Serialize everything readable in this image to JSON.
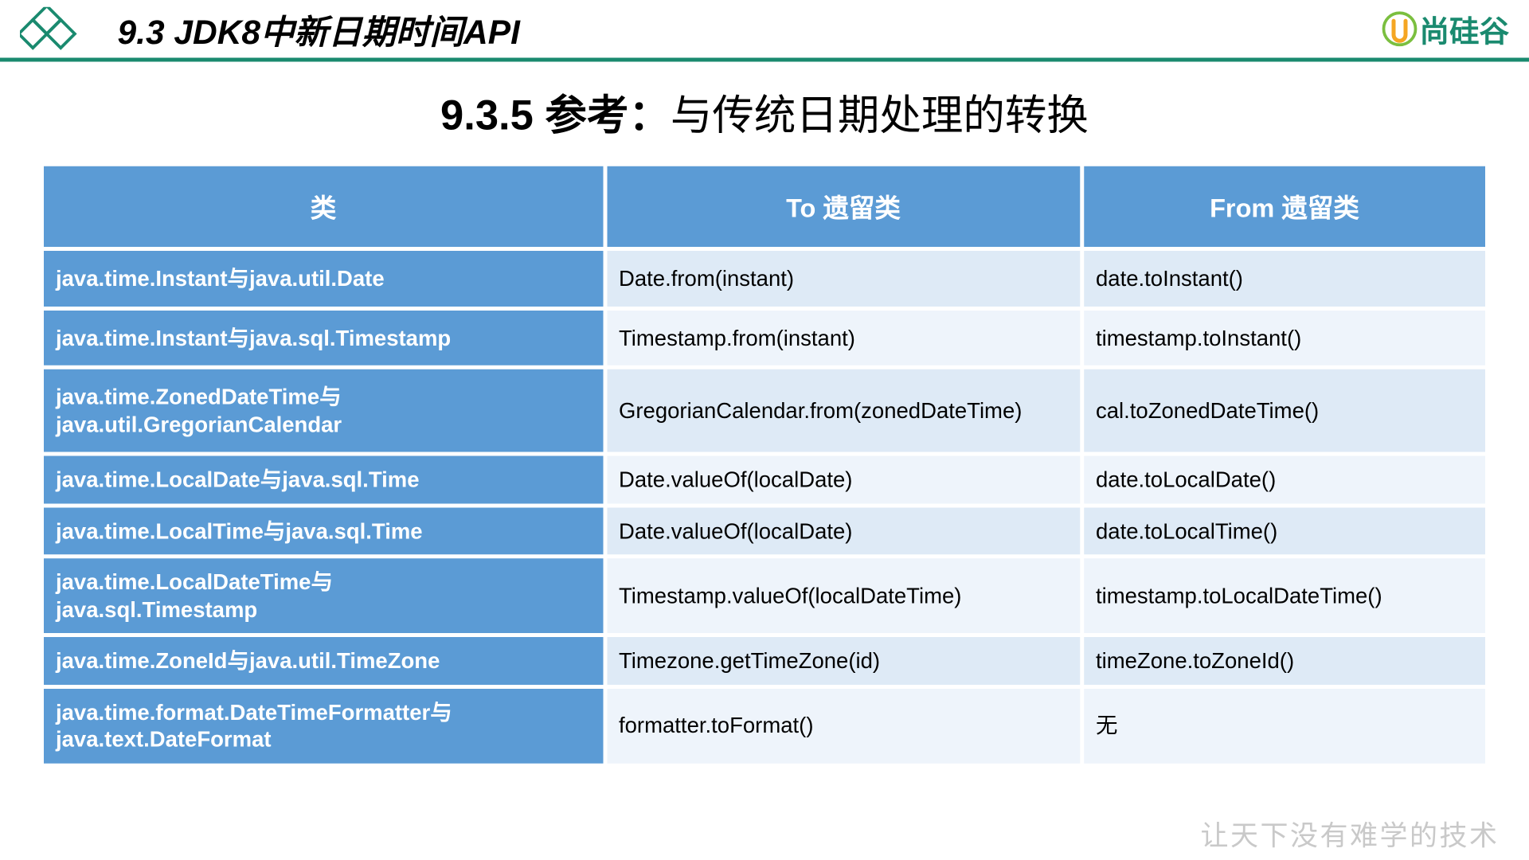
{
  "header": {
    "title": "9.3 JDK8中新日期时间API",
    "brand": "尚硅谷"
  },
  "subtitle": {
    "prefix_bold": "9.3.5 参考：",
    "rest": "与传统日期处理的转换"
  },
  "table": {
    "headers": {
      "class": "类",
      "to": "To 遗留类",
      "from": "From 遗留类"
    },
    "rows": [
      {
        "class": "java.time.Instant与java.util.Date",
        "to": "Date.from(instant)",
        "from": "date.toInstant()"
      },
      {
        "class": "java.time.Instant与java.sql.Timestamp",
        "to": "Timestamp.from(instant)",
        "from": "timestamp.toInstant()"
      },
      {
        "class": "java.time.ZonedDateTime与java.util.GregorianCalendar",
        "to": "GregorianCalendar.from(zonedDateTime)",
        "from": "cal.toZonedDateTime()"
      },
      {
        "class": "java.time.LocalDate与java.sql.Time",
        "to": "Date.valueOf(localDate)",
        "from": "date.toLocalDate()"
      },
      {
        "class": "java.time.LocalTime与java.sql.Time",
        "to": "Date.valueOf(localDate)",
        "from": "date.toLocalTime()"
      },
      {
        "class": "java.time.LocalDateTime与java.sql.Timestamp",
        "to": "Timestamp.valueOf(localDateTime)",
        "from": "timestamp.toLocalDateTime()"
      },
      {
        "class": "java.time.ZoneId与java.util.TimeZone",
        "to": "Timezone.getTimeZone(id)",
        "from": "timeZone.toZoneId()"
      },
      {
        "class": "java.time.format.DateTimeFormatter与java.text.DateFormat",
        "to": "formatter.toFormat()",
        "from": "无"
      }
    ]
  },
  "slogan": "让天下没有难学的技术"
}
